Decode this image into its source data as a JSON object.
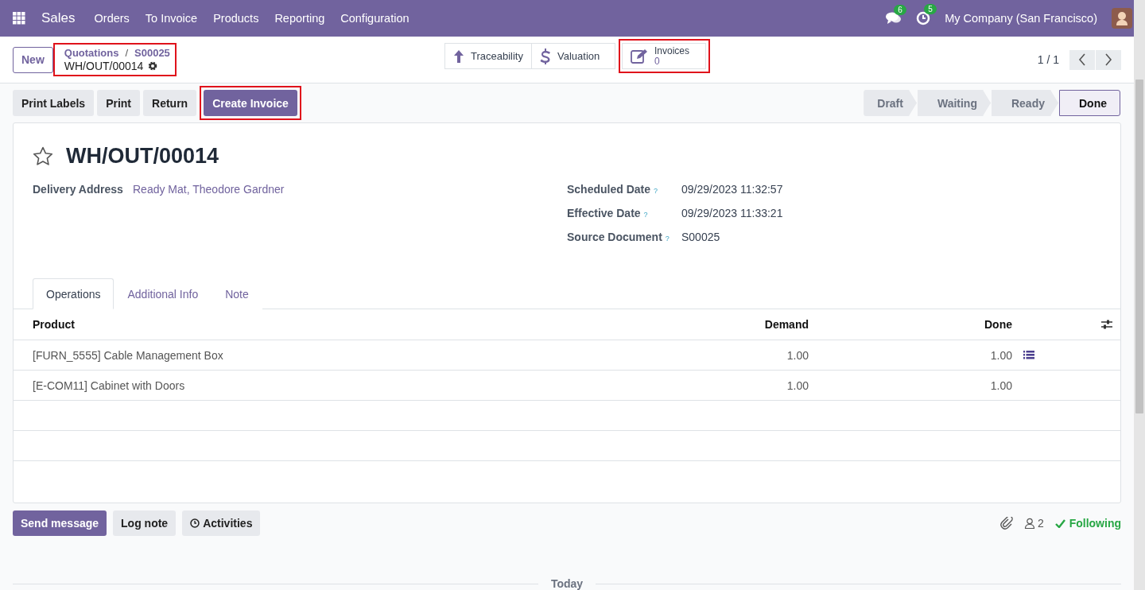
{
  "navbar": {
    "app": "Sales",
    "menu": [
      "Orders",
      "To Invoice",
      "Products",
      "Reporting",
      "Configuration"
    ],
    "messages_count": "6",
    "activities_count": "5",
    "company": "My Company (San Francisco)"
  },
  "control_panel": {
    "new_button": "New",
    "breadcrumb": {
      "parents": [
        "Quotations",
        "S00025"
      ],
      "separator": "/",
      "current": "WH/OUT/00014",
      "highlighted": true
    },
    "smart_buttons": [
      {
        "kind": "arrow",
        "label": "Traceability",
        "highlighted": false
      },
      {
        "kind": "dollar",
        "label": "Valuation",
        "highlighted": false
      },
      {
        "kind": "pencil",
        "label": "Invoices",
        "count": "0",
        "highlighted": true
      }
    ],
    "pager": "1 / 1"
  },
  "actions": [
    {
      "label": "Print Labels",
      "primary": false,
      "highlighted": false
    },
    {
      "label": "Print",
      "primary": false,
      "highlighted": false
    },
    {
      "label": "Return",
      "primary": false,
      "highlighted": false
    },
    {
      "label": "Create Invoice",
      "primary": true,
      "highlighted": true
    }
  ],
  "stages": [
    {
      "label": "Draft",
      "selected": false
    },
    {
      "label": "Waiting",
      "selected": false
    },
    {
      "label": "Ready",
      "selected": false
    },
    {
      "label": "Done",
      "selected": true
    }
  ],
  "record": {
    "title": "WH/OUT/00014",
    "starred": false,
    "left_fields": [
      {
        "label": "Delivery Address",
        "value": "Ready Mat, Theodore Gardner"
      }
    ],
    "right_fields": [
      {
        "label": "Scheduled Date",
        "help": "?",
        "value": "09/29/2023 11:32:57"
      },
      {
        "label": "Effective Date",
        "help": "?",
        "value": "09/29/2023 11:33:21"
      },
      {
        "label": "Source Document",
        "help": "?",
        "value": "S00025"
      }
    ],
    "tabs": [
      {
        "label": "Operations",
        "selected": true
      },
      {
        "label": "Additional Info",
        "selected": false
      },
      {
        "label": "Note",
        "selected": false
      }
    ],
    "table": {
      "columns": [
        "Product",
        "Demand",
        "Done"
      ],
      "rows": [
        {
          "product": "[FURN_5555] Cable Management Box",
          "demand": "1.00",
          "done": "1.00",
          "has_details": true
        },
        {
          "product": "[E-COM11] Cabinet with Doors",
          "demand": "1.00",
          "done": "1.00",
          "has_details": false
        }
      ]
    }
  },
  "chatter": {
    "buttons": [
      {
        "kind": "primary",
        "label": "Send message"
      },
      {
        "kind": "plain",
        "label": "Log note"
      },
      {
        "kind": "clock",
        "label": "Activities"
      }
    ],
    "followers": "2",
    "following": "Following",
    "separator": "Today"
  }
}
